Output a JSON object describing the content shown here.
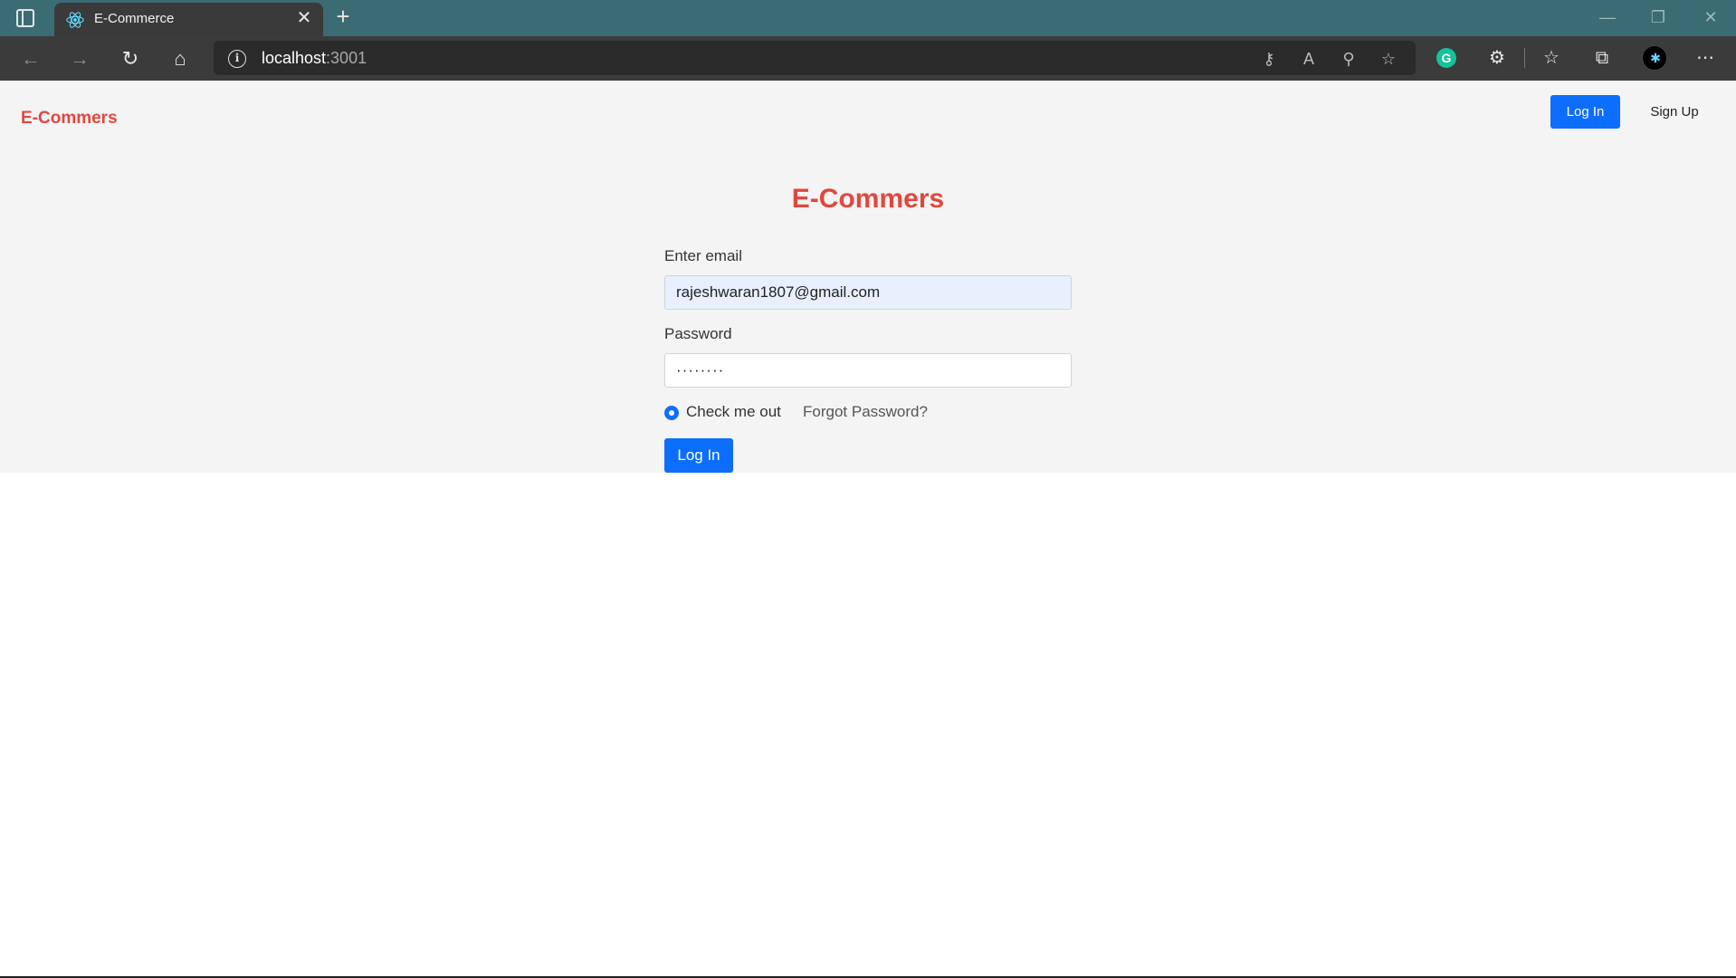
{
  "browser": {
    "tab_title": "E-Commerce",
    "new_tab_symbol": "+",
    "close_symbol": "✕",
    "url_host": "localhost",
    "url_port": ":3001"
  },
  "navbar": {
    "brand": "E-Commers",
    "login_label": "Log In",
    "signup_label": "Sign Up"
  },
  "form": {
    "heading": "E-Commers",
    "email_label": "Enter email",
    "email_value": "rajeshwaran1807@gmail.com",
    "password_label": "Password",
    "password_value": "········",
    "checkbox_label": "Check me out",
    "checkbox_checked": true,
    "forgot_link": "Forgot Password?",
    "submit_label": "Log In"
  },
  "colors": {
    "accent": "#0d6efd",
    "brand": "#e0483e",
    "titlebar": "#3b6b73"
  }
}
